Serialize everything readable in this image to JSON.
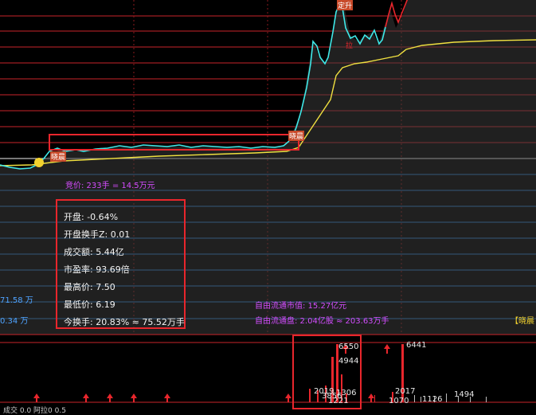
{
  "chart": {
    "auction_label": "竞价: 233手 = 14.5万元",
    "markers": {
      "m1": "晓晨",
      "m2": "晓晨",
      "m3": "定升",
      "m4": "拉"
    }
  },
  "stats": {
    "items": [
      {
        "label": "开盘",
        "value": "-0.64%"
      },
      {
        "label": "开盘换手Z",
        "value": "0.01"
      },
      {
        "label": "成交额",
        "value": "5.44亿"
      },
      {
        "label": "市盈率",
        "value": "93.69倍"
      },
      {
        "label": "最高价",
        "value": "7.50"
      },
      {
        "label": "最低价",
        "value": "6.19"
      },
      {
        "label": "今换手",
        "value": "20.83% ≈ 75.52万手"
      }
    ]
  },
  "left_labels": {
    "a": "71.58 万",
    "b": "0.34 万"
  },
  "float_info": {
    "cap": "自由流通市值: 15.27亿元",
    "shares": "自由流通盘: 2.04亿股 ≈ 203.63万手"
  },
  "corner_tag": "【晓晨",
  "volume_labels": {
    "v1": "6550",
    "v2": "4944",
    "v3": "2019",
    "v4": "1306",
    "v5": "3856",
    "v6": "1221",
    "v7": "6441",
    "v8": "2017",
    "v9": "1070",
    "v10": "1126",
    "v11": "1494"
  },
  "bottom_row": "成交  0.0  阿拉0  0.5"
}
